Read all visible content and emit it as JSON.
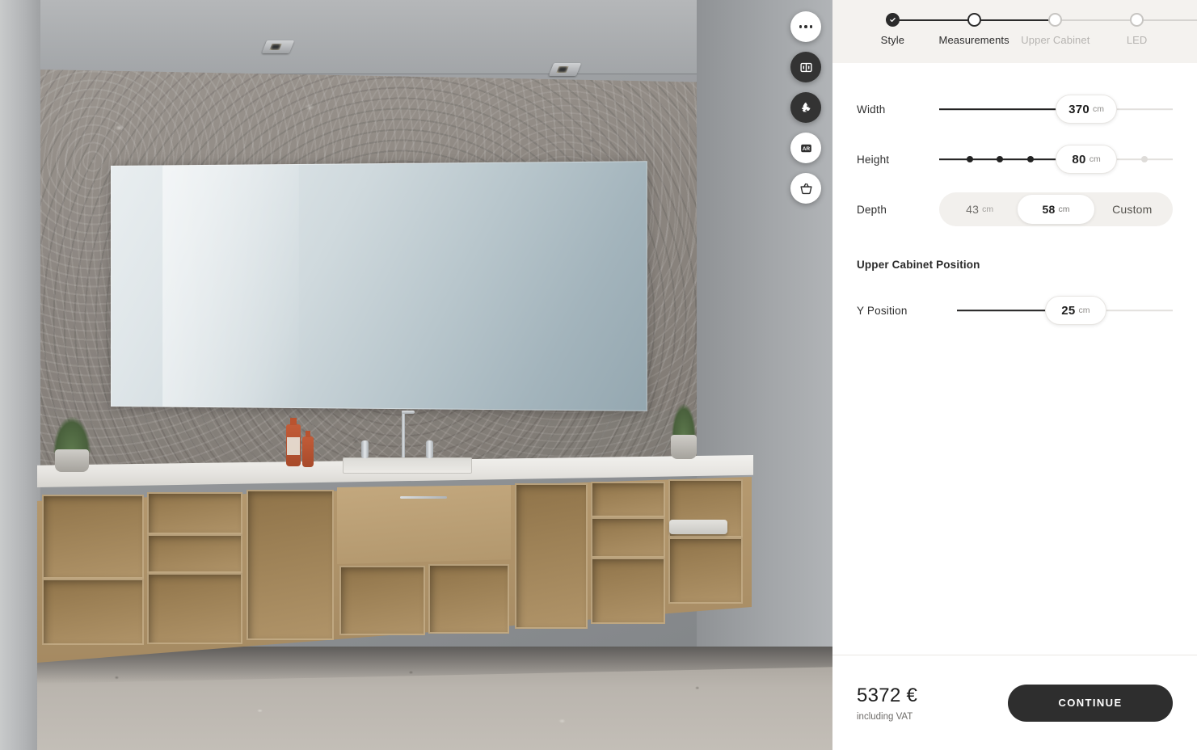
{
  "app": {
    "accent_dark": "#2e2e2e",
    "panel_bg": "#ffffff",
    "stepper_bg": "#f4f2ef"
  },
  "viewport": {
    "scene_name": "bathroom-vanity-3d-preview",
    "rail": [
      {
        "name": "more-options",
        "icon": "ellipsis-icon",
        "style": "light"
      },
      {
        "name": "compare-view",
        "icon": "split-view-icon",
        "style": "dark"
      },
      {
        "name": "sustainability",
        "icon": "recycle-icon",
        "style": "dark"
      },
      {
        "name": "augmented-reality",
        "icon": "ar-icon",
        "style": "light",
        "label": "AR"
      },
      {
        "name": "cart",
        "icon": "basket-icon",
        "style": "light"
      }
    ]
  },
  "stepper": {
    "steps": [
      {
        "label": "Style",
        "state": "done"
      },
      {
        "label": "Measurements",
        "state": "current"
      },
      {
        "label": "Upper Cabinet",
        "state": "todo"
      },
      {
        "label": "LED",
        "state": "todo"
      }
    ]
  },
  "controls": {
    "width": {
      "label": "Width",
      "value": "370",
      "unit": "cm",
      "fill_percent": 63,
      "ticks": []
    },
    "height": {
      "label": "Height",
      "value": "80",
      "unit": "cm",
      "fill_percent": 63,
      "ticks": [
        {
          "percent": 13,
          "state": "on"
        },
        {
          "percent": 26,
          "state": "on"
        },
        {
          "percent": 39,
          "state": "on"
        },
        {
          "percent": 88,
          "state": "off"
        }
      ]
    },
    "depth": {
      "label": "Depth",
      "options": [
        {
          "value": "43",
          "unit": "cm",
          "selected": false
        },
        {
          "value": "58",
          "unit": "cm",
          "selected": true
        },
        {
          "value": "Custom",
          "unit": "",
          "selected": false
        }
      ]
    },
    "upper_cabinet_position": {
      "section_title": "Upper Cabinet Position",
      "y_position": {
        "label": "Y Position",
        "value": "25",
        "unit": "cm",
        "fill_percent": 55,
        "ticks": []
      }
    }
  },
  "footer": {
    "price": "5372 €",
    "vat_note": "including VAT",
    "continue_label": "CONTINUE"
  }
}
